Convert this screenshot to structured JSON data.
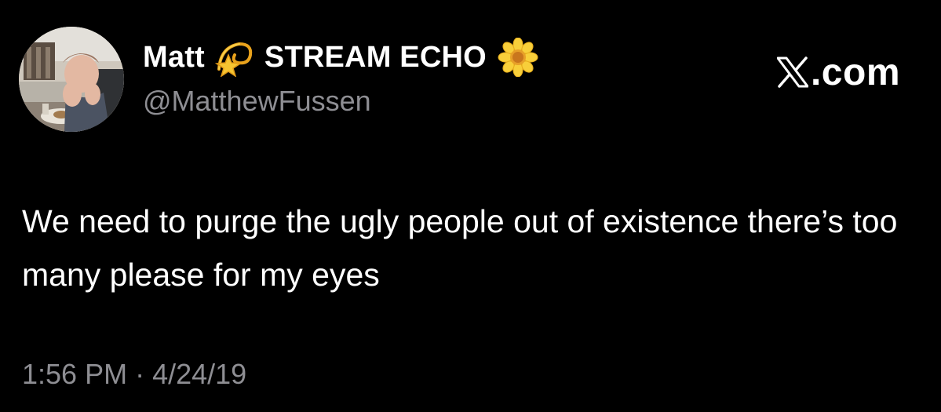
{
  "author": {
    "display_name": "Matt",
    "display_name_suffix": "STREAM ECHO",
    "handle": "@MatthewFussen",
    "emoji_1": "dizzy-star-icon",
    "emoji_2": "sunflower-icon"
  },
  "brand": {
    "label": ".com",
    "icon": "x-logo-icon"
  },
  "tweet": {
    "text": "We need to purge the ugly people out of existence there’s too many please for my eyes",
    "time": "1:56 PM",
    "separator": "·",
    "date": "4/24/19"
  },
  "colors": {
    "background": "#000000",
    "primary_text": "#ffffff",
    "secondary_text": "#8e8e93"
  }
}
